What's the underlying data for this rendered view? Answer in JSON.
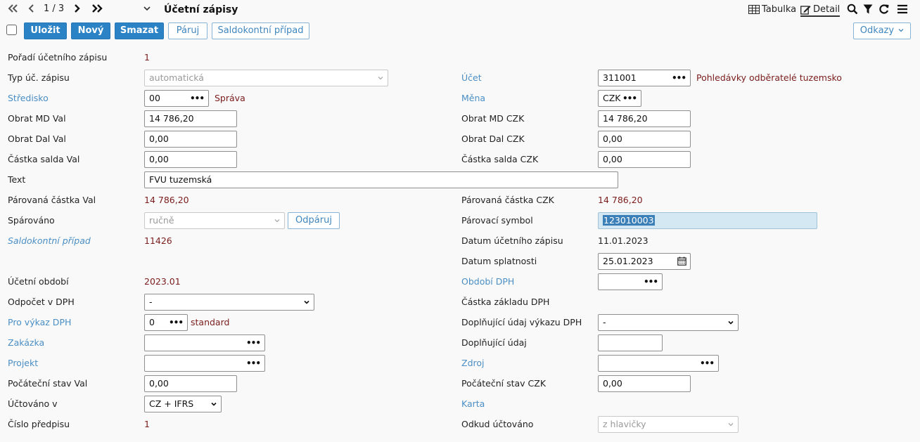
{
  "toolbar": {
    "pager": "1 / 3",
    "title": "Účetní zápisy",
    "view_table": "Tabulka",
    "view_detail": "Detail",
    "save": "Uložit",
    "new": "Nový",
    "delete": "Smazat",
    "pair": "Páruj",
    "account_case": "Saldokontní případ",
    "more": "Odkazy"
  },
  "form": {
    "poradi": {
      "label": "Pořadí účetního zápisu",
      "value": "1"
    },
    "typ": {
      "label": "Typ úč. zápisu",
      "value": "automatická"
    },
    "ucet": {
      "label": "Účet",
      "value": "311001",
      "desc": "Pohledávky odběratelé tuzemsko"
    },
    "stredisko": {
      "label": "Středisko",
      "value": "00",
      "desc": "Správa"
    },
    "mena": {
      "label": "Měna",
      "value": "CZK"
    },
    "obrat_md_val": {
      "label": "Obrat MD Val",
      "value": "14 786,20"
    },
    "obrat_md_czk": {
      "label": "Obrat MD CZK",
      "value": "14 786,20"
    },
    "obrat_dal_val": {
      "label": "Obrat Dal Val",
      "value": "0,00"
    },
    "obrat_dal_czk": {
      "label": "Obrat Dal CZK",
      "value": "0,00"
    },
    "castka_salda_val": {
      "label": "Částka salda Val",
      "value": "0,00"
    },
    "castka_salda_czk": {
      "label": "Částka salda CZK",
      "value": "0,00"
    },
    "text": {
      "label": "Text",
      "value": "FVU tuzemská"
    },
    "parovana_val": {
      "label": "Párovaná částka Val",
      "value": "14 786,20"
    },
    "parovana_czk": {
      "label": "Párovaná částka CZK",
      "value": "14 786,20"
    },
    "sparovano": {
      "label": "Spárováno",
      "value": "ručně",
      "button": "Odpáruj"
    },
    "parovaci_symbol": {
      "label": "Párovací symbol",
      "value": "123010003"
    },
    "saldokontni": {
      "label": "Saldokontní případ",
      "value": "11426"
    },
    "datum_zapisu": {
      "label": "Datum účetního zápisu",
      "value": "11.01.2023"
    },
    "datum_splatnosti": {
      "label": "Datum splatnosti",
      "value": "25.01.2023"
    },
    "ucetni_obdobi": {
      "label": "Účetní období",
      "value": "2023.01"
    },
    "obdobi_dph": {
      "label": "Období DPH",
      "value": ""
    },
    "odpocet_dph": {
      "label": "Odpočet v DPH",
      "value": "-"
    },
    "castka_zakladu": {
      "label": "Částka základu DPH"
    },
    "pro_vykaz": {
      "label": "Pro výkaz DPH",
      "value": "0",
      "desc": "standard"
    },
    "doplnujici_vykaz": {
      "label": "Doplňující údaj výkazu DPH",
      "value": "-"
    },
    "zakazka": {
      "label": "Zakázka",
      "value": ""
    },
    "doplnujici": {
      "label": "Doplňující údaj",
      "value": ""
    },
    "projekt": {
      "label": "Projekt",
      "value": ""
    },
    "zdroj": {
      "label": "Zdroj",
      "value": ""
    },
    "pocatecni_val": {
      "label": "Počáteční stav Val",
      "value": "0,00"
    },
    "pocatecni_czk": {
      "label": "Počáteční stav CZK",
      "value": "0,00"
    },
    "uctovano_v": {
      "label": "Účtováno v",
      "value": "CZ + IFRS"
    },
    "karta": {
      "label": "Karta"
    },
    "cislo_predpisu": {
      "label": "Číslo předpisu",
      "value": "1"
    },
    "odkud": {
      "label": "Odkud účtováno",
      "value": "z hlavičky"
    }
  }
}
